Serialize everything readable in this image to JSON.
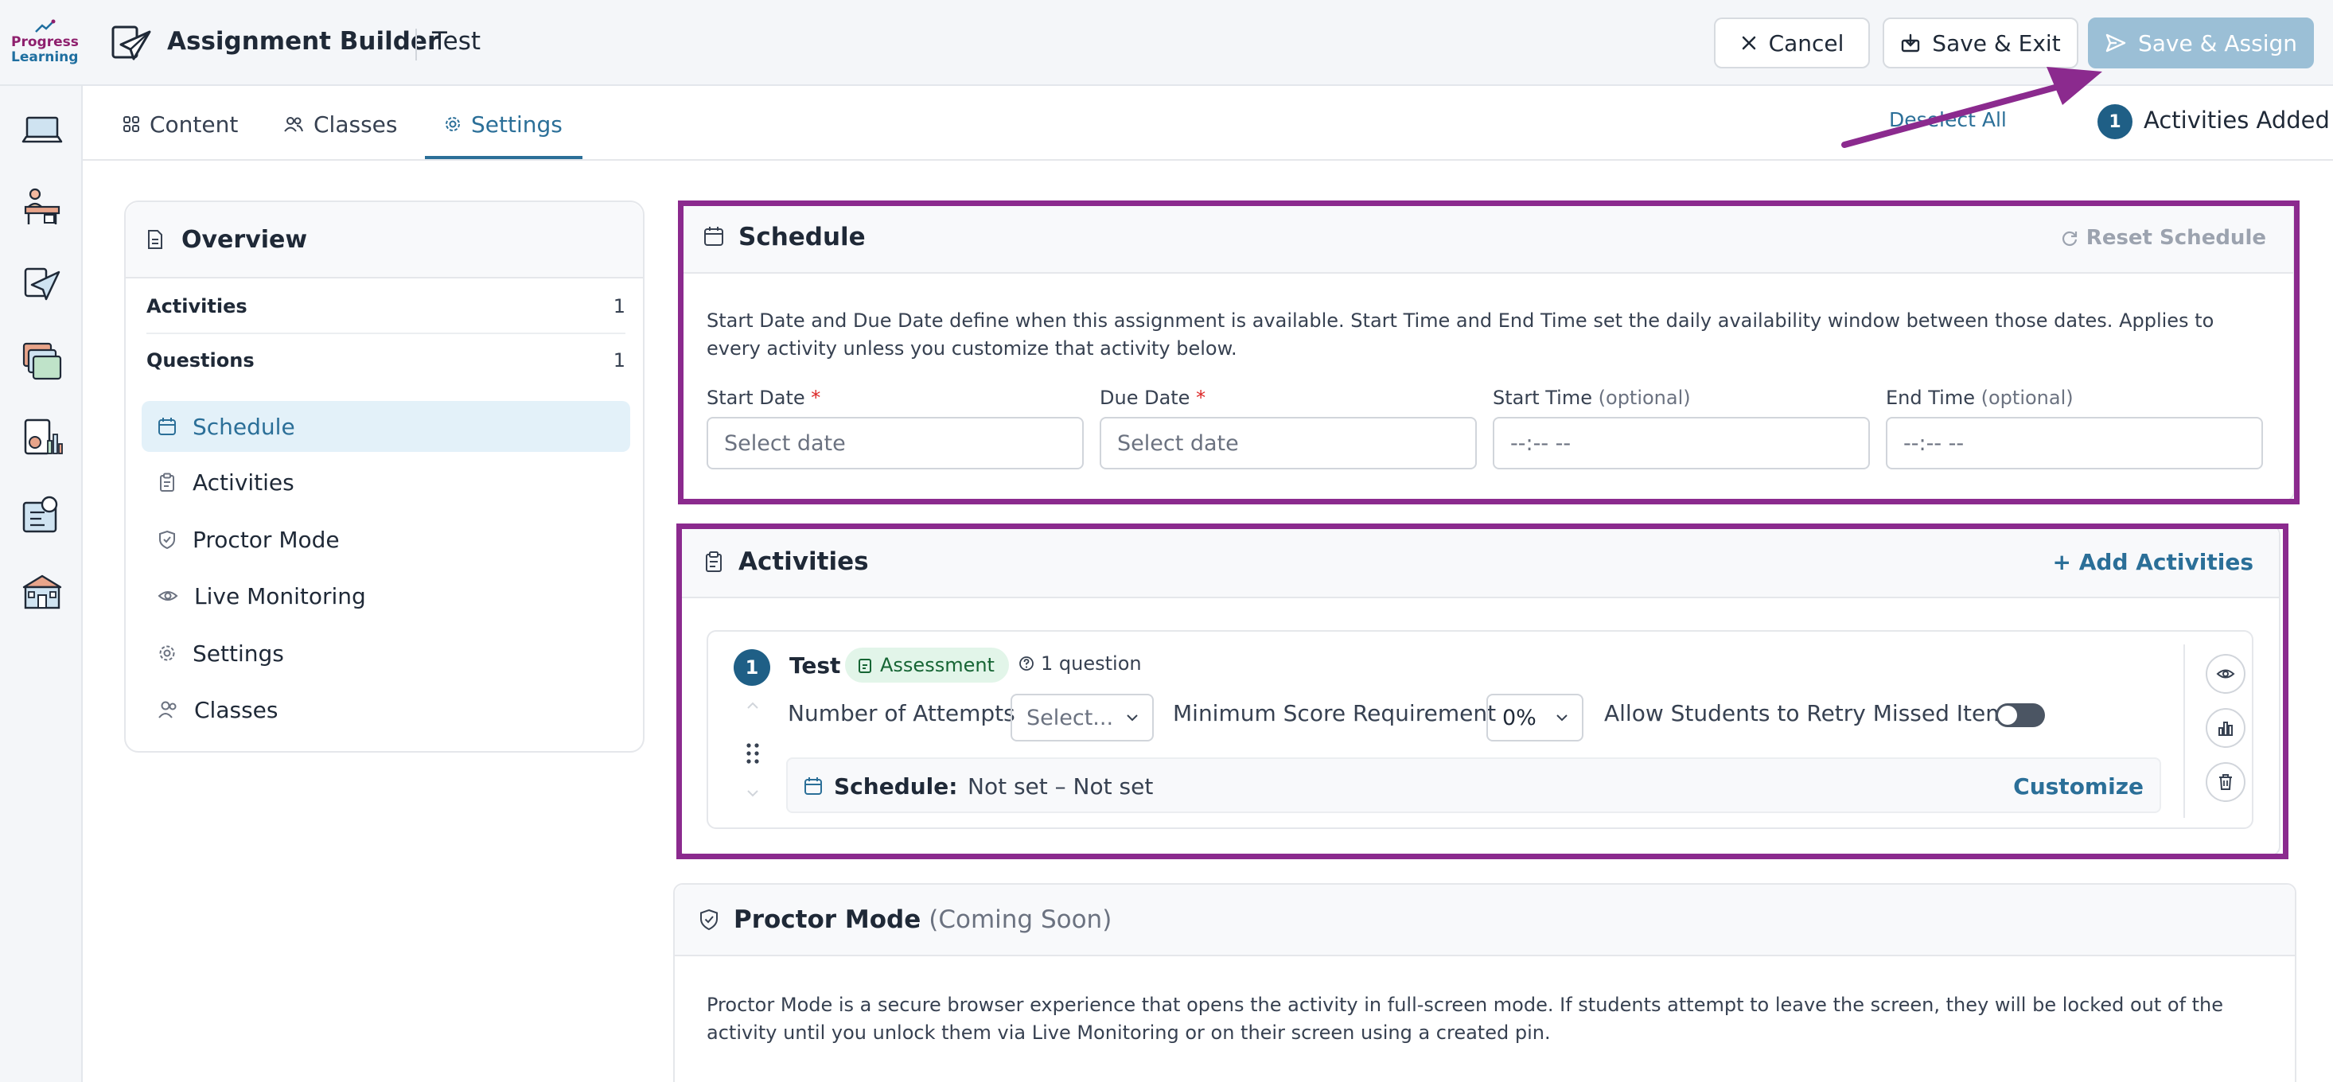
{
  "logo": {
    "line1": "Progress",
    "line2": "Learning"
  },
  "header": {
    "title": "Assignment Builder",
    "subtitle": "Test",
    "cancel_label": "Cancel",
    "save_exit_label": "Save & Exit",
    "save_assign_label": "Save & Assign"
  },
  "tabs": {
    "content": "Content",
    "classes": "Classes",
    "settings": "Settings",
    "active": "Settings",
    "deselect_all": "Deselect All",
    "activities_count": "1",
    "activities_added": "Activities Added"
  },
  "overview": {
    "title": "Overview",
    "stats": [
      {
        "label": "Activities",
        "value": "1"
      },
      {
        "label": "Questions",
        "value": "1"
      }
    ],
    "nav": [
      {
        "label": "Schedule",
        "active": true
      },
      {
        "label": "Activities"
      },
      {
        "label": "Proctor Mode"
      },
      {
        "label": "Live Monitoring"
      },
      {
        "label": "Settings"
      },
      {
        "label": "Classes"
      }
    ]
  },
  "schedule": {
    "title": "Schedule",
    "reset_label": "Reset Schedule",
    "description": "Start Date and Due Date define when this assignment is available. Start Time and End Time set the daily availability window between those dates. Applies to every activity unless you customize that activity below.",
    "fields": [
      {
        "label": "Start Date",
        "required": "*",
        "optional": "",
        "placeholder": "Select date"
      },
      {
        "label": "Due Date",
        "required": "*",
        "optional": "",
        "placeholder": "Select date"
      },
      {
        "label": "Start Time",
        "required": "",
        "optional": "(optional)",
        "placeholder": "--:-- --"
      },
      {
        "label": "End Time",
        "required": "",
        "optional": "(optional)",
        "placeholder": "--:-- --"
      }
    ]
  },
  "activities": {
    "title": "Activities",
    "add_label": "+ Add Activities",
    "items": [
      {
        "number": "1",
        "name": "Test",
        "type_badge": "Assessment",
        "questions": "1 question",
        "attempts_label": "Number of Attempts",
        "attempts_value": "Select...",
        "min_score_label": "Minimum Score Requirement",
        "min_score_value": "0%",
        "retry_label": "Allow Students to Retry Missed Items",
        "retry_enabled": false,
        "schedule_label": "Schedule:",
        "schedule_value": "Not set – Not set",
        "customize_label": "Customize"
      }
    ]
  },
  "proctor": {
    "title": "Proctor Mode",
    "subtitle": "(Coming Soon)",
    "description": "Proctor Mode is a secure browser experience that opens the activity in full-screen mode. If students attempt to leave the screen, they will be locked out of the activity until you unlock them via Live Monitoring or on their screen using a created pin."
  },
  "colors": {
    "accent": "#2b6f98",
    "annotation": "#8b2a8e",
    "assign_button": "#9bbfd6"
  },
  "icons": {
    "rail": [
      "laptop-icon",
      "teacher-desk-icon",
      "send-assignment-icon",
      "folders-icon",
      "reports-icon",
      "lesson-plan-icon",
      "school-icon"
    ]
  }
}
